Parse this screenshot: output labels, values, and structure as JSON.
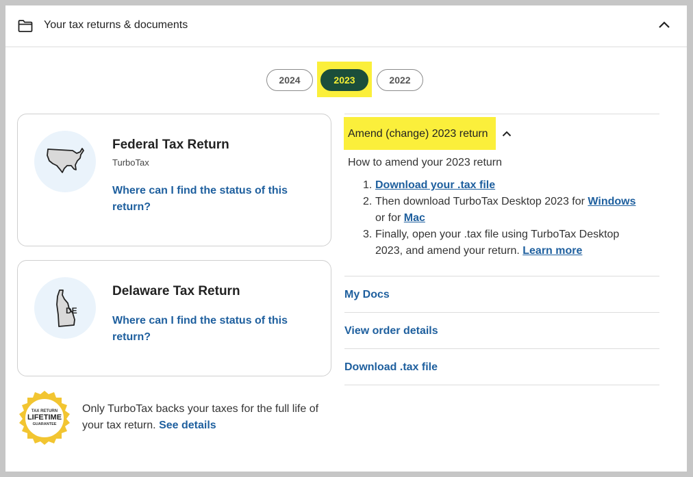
{
  "header": {
    "title": "Your tax returns & documents",
    "folder_icon": "folder-icon",
    "collapse_icon": "chevron-up-icon"
  },
  "years": {
    "items": [
      "2024",
      "2023",
      "2022"
    ],
    "selected": "2023"
  },
  "cards": [
    {
      "title": "Federal Tax Return",
      "subtitle": "TurboTax",
      "icon": "usa-map-icon",
      "link_line1": "Where can I find the status of this",
      "link_line2": "return?"
    },
    {
      "title": "Delaware Tax Return",
      "icon": "delaware-map-icon",
      "state_abbr": "DE",
      "link_line1": "Where can I find the status of this",
      "link_line2": "return?"
    }
  ],
  "guarantee": {
    "badge_top": "TAX RETURN",
    "badge_main": "LIFETIME",
    "badge_bottom": "GUARANTEE",
    "text_line1": "Only TurboTax backs your taxes for the full life of",
    "text_line2": "your tax return.",
    "link": "See details"
  },
  "amend": {
    "title": "Amend (change) 2023 return",
    "intro": "How to amend your 2023 return",
    "step1_num": "1.",
    "step1_link": "Download your .tax file",
    "step2_num": "2.",
    "step2_text_a": "Then download TurboTax Desktop 2023 for ",
    "step2_link_windows": "Windows",
    "step2_text_b": "or for ",
    "step2_link_mac": "Mac",
    "step3_num": "3.",
    "step3_text_a": "Finally, open your .tax file using TurboTax Desktop",
    "step3_text_b": "2023, and amend your return. ",
    "step3_link": "Learn more"
  },
  "links": {
    "my_docs": "My Docs",
    "view_order": "View order details",
    "download_tax": "Download .tax file"
  },
  "colors": {
    "highlight": "#fbef3b",
    "active_pill": "#1b4e3b",
    "link": "#1e5f9e",
    "badge_gold": "#f2c531"
  }
}
